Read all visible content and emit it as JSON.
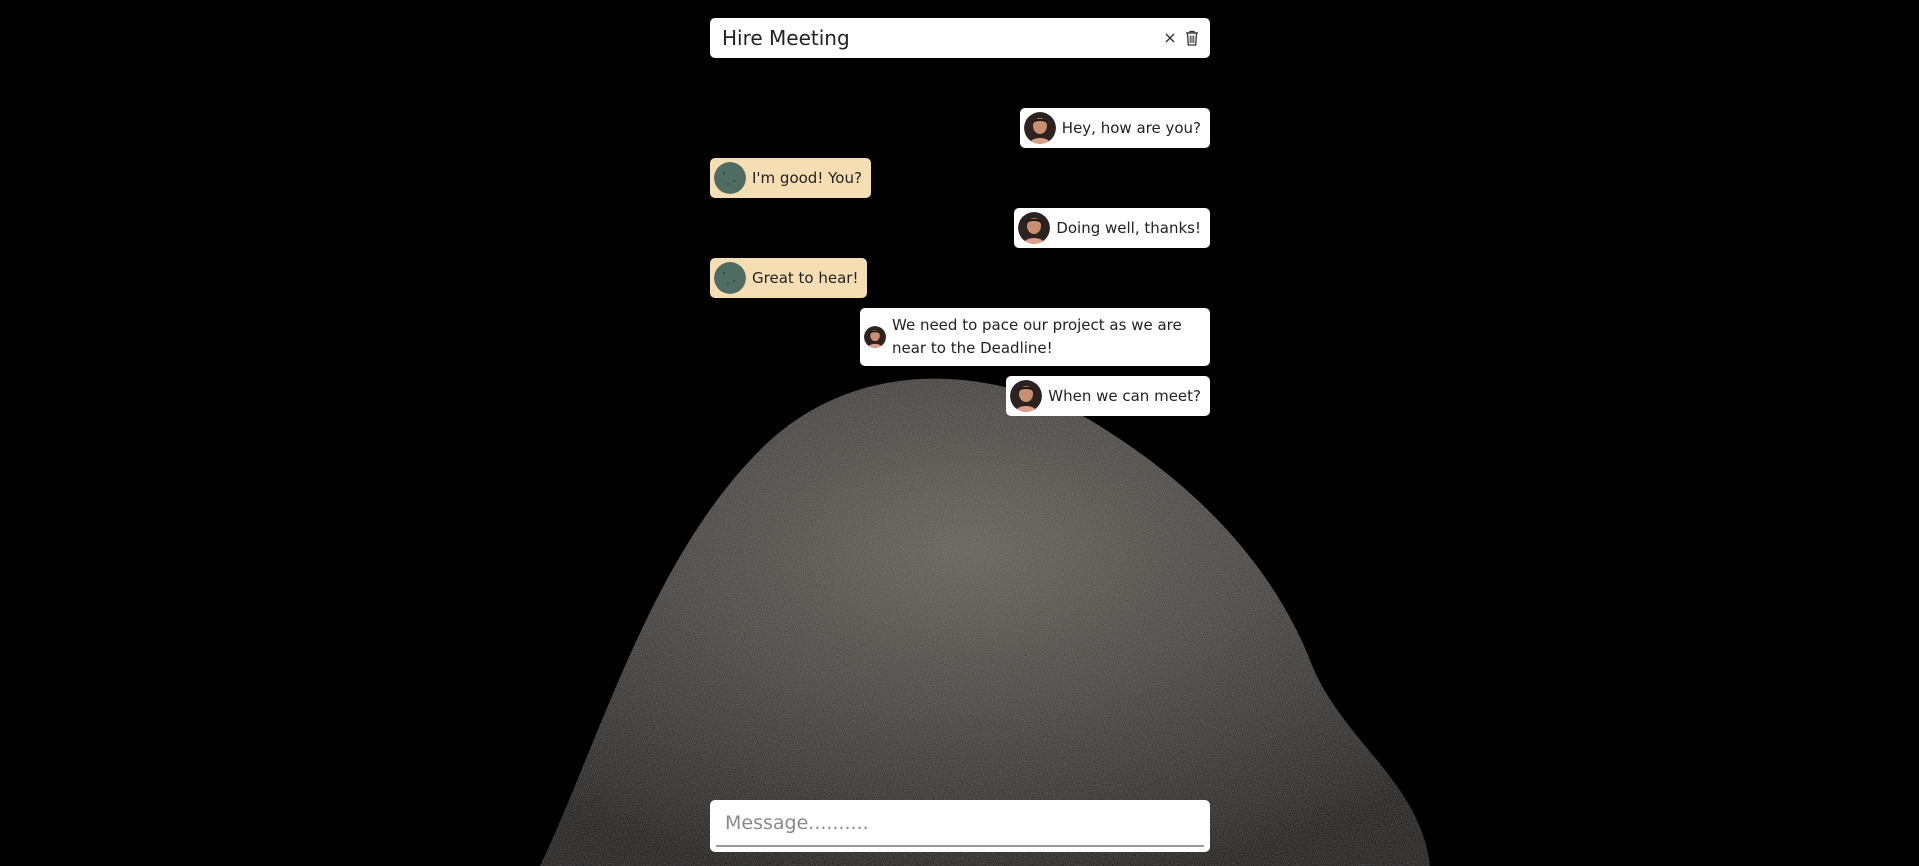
{
  "chat": {
    "title": "Hire Meeting",
    "close_icon": "close-icon",
    "delete_icon": "trash-icon"
  },
  "messages": [
    {
      "side": "out",
      "sender": "user",
      "text": "Hey, how are you?"
    },
    {
      "side": "in",
      "sender": "contact",
      "text": "I'm good! You?"
    },
    {
      "side": "out",
      "sender": "user",
      "text": "Doing well, thanks!"
    },
    {
      "side": "in",
      "sender": "contact",
      "text": "Great to hear!"
    },
    {
      "side": "out",
      "sender": "user",
      "text": "We need to pace our project as we are near to the Deadline!"
    },
    {
      "side": "out",
      "sender": "user",
      "text": "When we can meet?"
    }
  ],
  "composer": {
    "placeholder": "Message.........."
  },
  "colors": {
    "outgoing_bubble": "#ffffff",
    "incoming_bubble": "#f5deb3",
    "page_background": "#000000"
  }
}
